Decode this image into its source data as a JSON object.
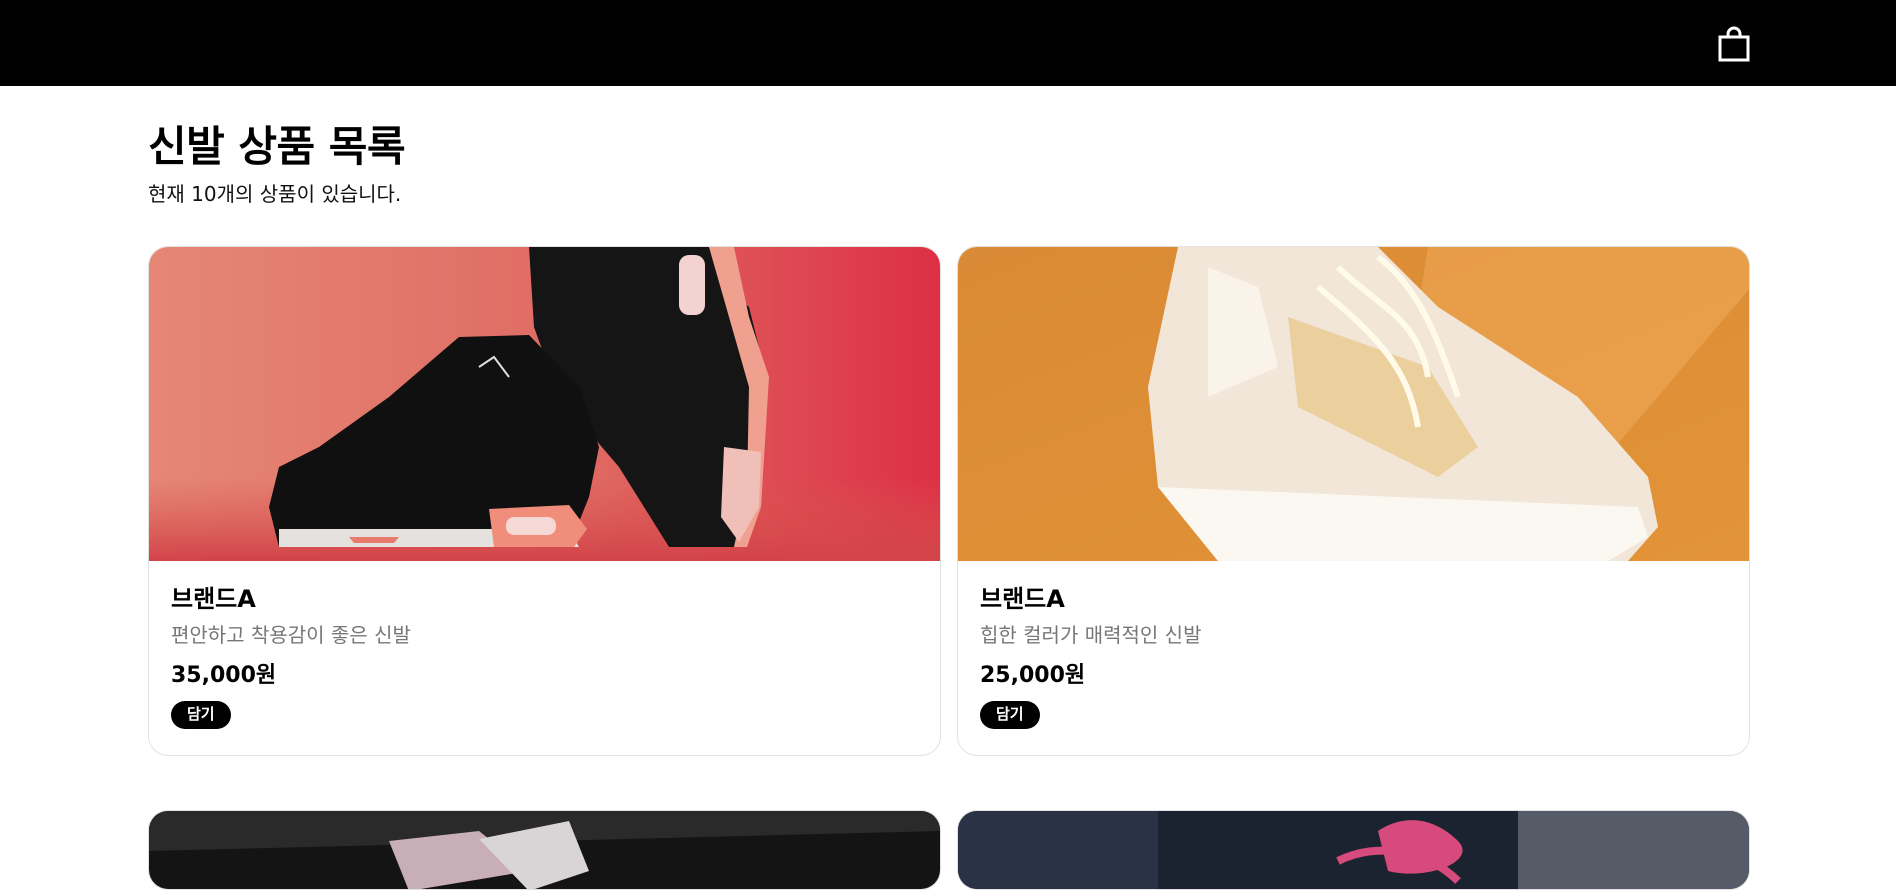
{
  "header": {
    "cart_icon": "shopping-bag-icon"
  },
  "main": {
    "title": "신발 상품 목록",
    "subtitle": "현재 10개의 상품이 있습니다."
  },
  "products": [
    {
      "brand": "브랜드A",
      "description": "편안하고 착용감이 좋은 신발",
      "price": "35,000원",
      "button": "담기",
      "image": "black-sneakers-red-background"
    },
    {
      "brand": "브랜드A",
      "description": "힙한 컬러가 매력적인 신발",
      "price": "25,000원",
      "button": "담기",
      "image": "white-sneaker-orange-background"
    }
  ],
  "partial_products": [
    {
      "image": "pink-sneaker-dark-fur"
    },
    {
      "image": "pink-laces-dark-background"
    }
  ],
  "colors": {
    "topbar": "#000000",
    "button": "#000000",
    "muted_text": "#777777"
  }
}
